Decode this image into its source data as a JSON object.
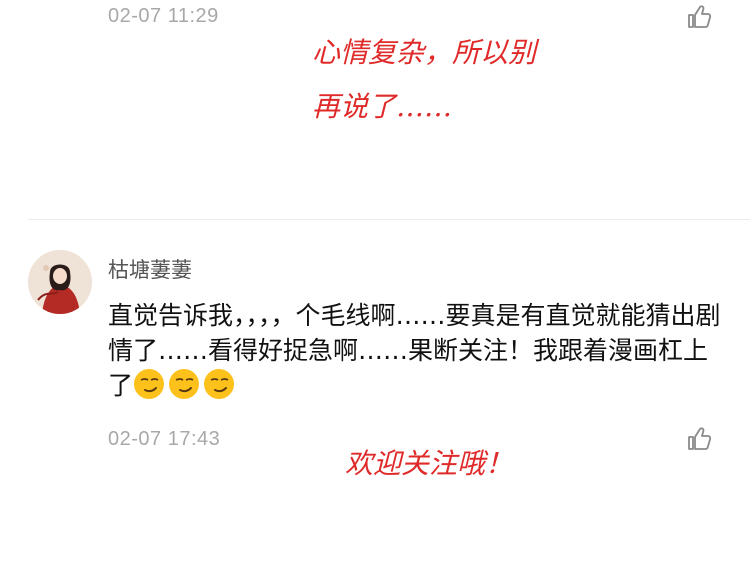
{
  "first_comment": {
    "timestamp": "02-07 11:29",
    "reply": {
      "line1": "心情复杂，所以别",
      "line2": "再说了……"
    }
  },
  "second_comment": {
    "username": "枯塘萋萋",
    "text": "直觉告诉我，，，，个毛线啊……要真是有直觉就能猜出剧情了……看得好捉急啊……果断关注！我跟着漫画杠上了",
    "emojis": [
      "smirk-emoji",
      "smirk-emoji",
      "smirk-emoji"
    ],
    "timestamp": "02-07 17:43",
    "reply": "欢迎关注哦！"
  },
  "icons": {
    "like": "thumbs-up-icon",
    "avatar": "avatar-illustration"
  },
  "colors": {
    "reply_text": "#e02a2a",
    "timestamp": "#a8a8a8",
    "username": "#555555",
    "body_text": "#111111",
    "divider": "#ececec"
  }
}
